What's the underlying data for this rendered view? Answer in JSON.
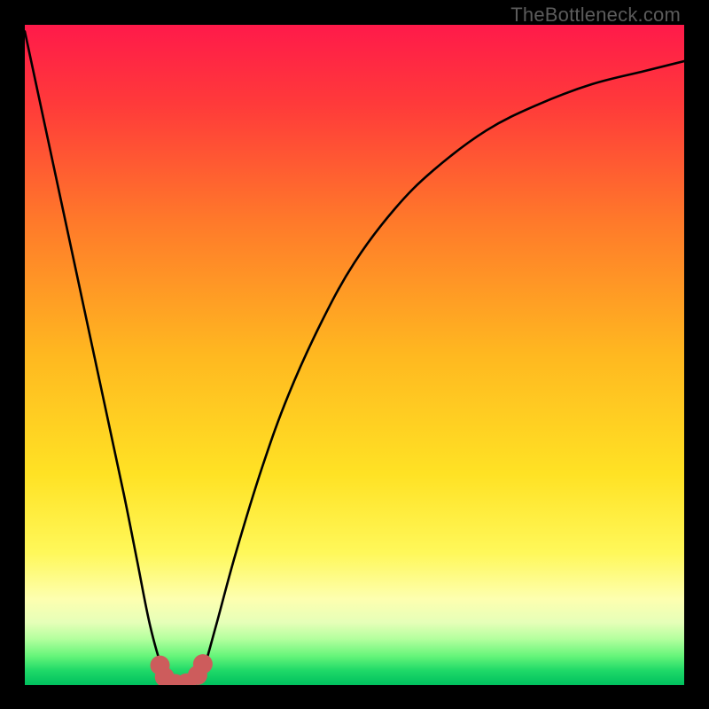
{
  "watermark": "TheBottleneck.com",
  "chart_data": {
    "type": "line",
    "title": "",
    "xlabel": "",
    "ylabel": "",
    "xlim": [
      0,
      100
    ],
    "ylim": [
      0,
      100
    ],
    "grid": false,
    "series": [
      {
        "name": "bottleneck-curve",
        "x": [
          0,
          3,
          6,
          9,
          12,
          15,
          17,
          19,
          21,
          22,
          23,
          24,
          25,
          26,
          27,
          29,
          32,
          36,
          40,
          45,
          50,
          56,
          62,
          70,
          78,
          86,
          94,
          100
        ],
        "y": [
          99,
          85,
          71,
          57,
          43,
          29,
          19,
          9,
          2,
          0.5,
          0,
          0,
          0,
          0.5,
          2,
          9,
          20,
          33,
          44,
          55,
          64,
          72,
          78,
          84,
          88,
          91,
          93,
          94.5
        ]
      }
    ],
    "markers": {
      "name": "highlight-dots",
      "color": "#cd5c5c",
      "points": [
        {
          "x": 20.5,
          "y": 3.0
        },
        {
          "x": 21.2,
          "y": 1.2
        },
        {
          "x": 22.8,
          "y": 0.2
        },
        {
          "x": 24.5,
          "y": 0.3
        },
        {
          "x": 26.2,
          "y": 1.5
        },
        {
          "x": 27.0,
          "y": 3.2
        }
      ]
    },
    "background": {
      "type": "vertical-gradient",
      "stops": [
        {
          "pos": 0.0,
          "color": "#ff1a4a"
        },
        {
          "pos": 0.12,
          "color": "#ff3a3a"
        },
        {
          "pos": 0.3,
          "color": "#ff7a2a"
        },
        {
          "pos": 0.5,
          "color": "#ffb820"
        },
        {
          "pos": 0.68,
          "color": "#ffe224"
        },
        {
          "pos": 0.8,
          "color": "#fff85a"
        },
        {
          "pos": 0.87,
          "color": "#fdffb0"
        },
        {
          "pos": 0.905,
          "color": "#e6ffb8"
        },
        {
          "pos": 0.93,
          "color": "#b4ff9e"
        },
        {
          "pos": 0.956,
          "color": "#66f57a"
        },
        {
          "pos": 0.978,
          "color": "#1fd968"
        },
        {
          "pos": 1.0,
          "color": "#00c05e"
        }
      ]
    }
  }
}
